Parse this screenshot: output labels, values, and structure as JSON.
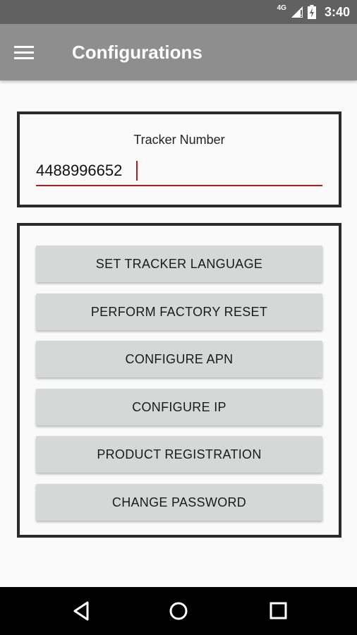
{
  "status_bar": {
    "network": "4G",
    "time": "3:40",
    "icons": [
      "signal-icon",
      "battery-charging-icon"
    ]
  },
  "app_bar": {
    "menu_icon": "hamburger-menu-icon",
    "title": "Configurations"
  },
  "tracker": {
    "label": "Tracker Number",
    "value": "4488996652",
    "accent_color": "#b71c1c"
  },
  "actions": [
    {
      "label": "SET TRACKER LANGUAGE"
    },
    {
      "label": "PERFORM FACTORY RESET"
    },
    {
      "label": "CONFIGURE APN"
    },
    {
      "label": "CONFIGURE IP"
    },
    {
      "label": "PRODUCT REGISTRATION"
    },
    {
      "label": "CHANGE PASSWORD"
    }
  ],
  "nav_bar": {
    "icons": [
      "back-icon",
      "home-icon",
      "recents-icon"
    ]
  },
  "colors": {
    "status_bar": "#616161",
    "app_bar": "#8e8e8e",
    "button": "#d6d7d7",
    "border": "#2b2b2b"
  }
}
